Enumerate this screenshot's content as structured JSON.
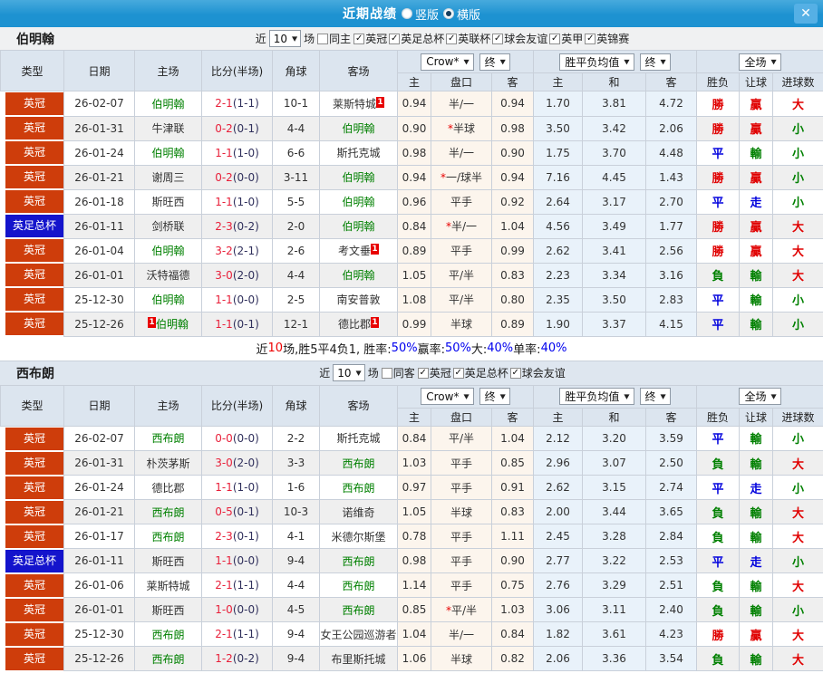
{
  "topbar": {
    "title": "近期战绩",
    "radios": [
      {
        "label": "竖版",
        "selected": false
      },
      {
        "label": "横版",
        "selected": true
      }
    ],
    "close_glyph": "✕"
  },
  "glyphs": {
    "check": "✓",
    "arrow": "▼",
    "star": "*"
  },
  "colors": {
    "topbar_blue": "#1d92d1",
    "close_btn_blue": "#55b0e5",
    "league_orange": "#ce3d0b",
    "league_cup_blue": "#1414cc",
    "team_green": "#008000",
    "score_red": "#e8203a",
    "half_score_navy": "#30305c",
    "odds_col_bg": "#fcf5ed",
    "avg_col_bg": "#e9f2fa",
    "row_stripe": "#efefef",
    "header_bg": "#dce5ef",
    "result_red": "#e00000",
    "result_green": "#008000",
    "result_blue": "#0000dd",
    "percent_blue": "#0000ee",
    "card_red": "#e80000"
  },
  "league_colors": {
    "英冠": "league_orange",
    "英足总杯": "league_cup_blue"
  },
  "result_classes": {
    "勝": "red",
    "負": "green",
    "平": "blue",
    "贏": "red",
    "輸": "green",
    "走": "blue",
    "大": "red",
    "小": "green"
  },
  "table_header": {
    "main": [
      "类型",
      "日期",
      "主场",
      "比分(半场)",
      "角球",
      "客场"
    ],
    "sub": [
      "主",
      "盘口",
      "客",
      "主",
      "和",
      "客",
      "胜负",
      "让球",
      "进球数"
    ],
    "company": "Crow*",
    "period": "终",
    "avg_label": "胜平负均值",
    "full_label": "全场"
  },
  "sections": [
    {
      "team": "伯明翰",
      "filters": {
        "recent_label": "近",
        "count": "10",
        "games_label": "场",
        "same_label": "同主",
        "same_checked": false,
        "leagues": [
          {
            "label": "英冠",
            "checked": true
          },
          {
            "label": "英足总杯",
            "checked": true
          },
          {
            "label": "英联杯",
            "checked": true
          },
          {
            "label": "球会友谊",
            "checked": true
          },
          {
            "label": "英甲",
            "checked": true
          },
          {
            "label": "英锦赛",
            "checked": true
          }
        ]
      },
      "rows": [
        {
          "type": "英冠",
          "date": "26-02-07",
          "home": {
            "name": "伯明翰",
            "green": true
          },
          "ft": "2-1",
          "ht": "(1-1)",
          "corner": "10-1",
          "away": {
            "name": "莱斯特城",
            "card": "1"
          },
          "o1": "0.94",
          "hstar": false,
          "handicap": "半/一",
          "o2": "0.94",
          "a1": "1.70",
          "a2": "3.81",
          "a3": "4.72",
          "res": "勝",
          "hres": "贏",
          "gres": "大"
        },
        {
          "type": "英冠",
          "date": "26-01-31",
          "home": {
            "name": "牛津联"
          },
          "ft": "0-2",
          "ht": "(0-1)",
          "corner": "4-4",
          "away": {
            "name": "伯明翰",
            "green": true
          },
          "o1": "0.90",
          "hstar": true,
          "handicap": "半球",
          "o2": "0.98",
          "a1": "3.50",
          "a2": "3.42",
          "a3": "2.06",
          "res": "勝",
          "hres": "贏",
          "gres": "小"
        },
        {
          "type": "英冠",
          "date": "26-01-24",
          "home": {
            "name": "伯明翰",
            "green": true
          },
          "ft": "1-1",
          "ht": "(1-0)",
          "corner": "6-6",
          "away": {
            "name": "斯托克城"
          },
          "o1": "0.98",
          "hstar": false,
          "handicap": "半/一",
          "o2": "0.90",
          "a1": "1.75",
          "a2": "3.70",
          "a3": "4.48",
          "res": "平",
          "hres": "輸",
          "gres": "小"
        },
        {
          "type": "英冠",
          "date": "26-01-21",
          "home": {
            "name": "谢周三"
          },
          "ft": "0-2",
          "ht": "(0-0)",
          "corner": "3-11",
          "away": {
            "name": "伯明翰",
            "green": true
          },
          "o1": "0.94",
          "hstar": true,
          "handicap": "一/球半",
          "o2": "0.94",
          "a1": "7.16",
          "a2": "4.45",
          "a3": "1.43",
          "res": "勝",
          "hres": "贏",
          "gres": "小"
        },
        {
          "type": "英冠",
          "date": "26-01-18",
          "home": {
            "name": "斯旺西"
          },
          "ft": "1-1",
          "ht": "(1-0)",
          "corner": "5-5",
          "away": {
            "name": "伯明翰",
            "green": true
          },
          "o1": "0.96",
          "hstar": false,
          "handicap": "平手",
          "o2": "0.92",
          "a1": "2.64",
          "a2": "3.17",
          "a3": "2.70",
          "res": "平",
          "hres": "走",
          "gres": "小"
        },
        {
          "type": "英足总杯",
          "date": "26-01-11",
          "home": {
            "name": "剑桥联"
          },
          "ft": "2-3",
          "ht": "(0-2)",
          "corner": "2-0",
          "away": {
            "name": "伯明翰",
            "green": true
          },
          "o1": "0.84",
          "hstar": true,
          "handicap": "半/一",
          "o2": "1.04",
          "a1": "4.56",
          "a2": "3.49",
          "a3": "1.77",
          "res": "勝",
          "hres": "贏",
          "gres": "大"
        },
        {
          "type": "英冠",
          "date": "26-01-04",
          "home": {
            "name": "伯明翰",
            "green": true
          },
          "ft": "3-2",
          "ht": "(2-1)",
          "corner": "2-6",
          "away": {
            "name": "考文垂",
            "card": "1"
          },
          "o1": "0.89",
          "hstar": false,
          "handicap": "平手",
          "o2": "0.99",
          "a1": "2.62",
          "a2": "3.41",
          "a3": "2.56",
          "res": "勝",
          "hres": "贏",
          "gres": "大"
        },
        {
          "type": "英冠",
          "date": "26-01-01",
          "home": {
            "name": "沃特福德"
          },
          "ft": "3-0",
          "ht": "(2-0)",
          "corner": "4-4",
          "away": {
            "name": "伯明翰",
            "green": true
          },
          "o1": "1.05",
          "hstar": false,
          "handicap": "平/半",
          "o2": "0.83",
          "a1": "2.23",
          "a2": "3.34",
          "a3": "3.16",
          "res": "負",
          "hres": "輸",
          "gres": "大"
        },
        {
          "type": "英冠",
          "date": "25-12-30",
          "home": {
            "name": "伯明翰",
            "green": true
          },
          "ft": "1-1",
          "ht": "(0-0)",
          "corner": "2-5",
          "away": {
            "name": "南安普敦"
          },
          "o1": "1.08",
          "hstar": false,
          "handicap": "平/半",
          "o2": "0.80",
          "a1": "2.35",
          "a2": "3.50",
          "a3": "2.83",
          "res": "平",
          "hres": "輸",
          "gres": "小"
        },
        {
          "type": "英冠",
          "date": "25-12-26",
          "home": {
            "name": "伯明翰",
            "green": true,
            "card": "1"
          },
          "ft": "1-1",
          "ht": "(0-1)",
          "corner": "12-1",
          "away": {
            "name": "德比郡",
            "card": "1"
          },
          "o1": "0.99",
          "hstar": false,
          "handicap": "半球",
          "o2": "0.89",
          "a1": "1.90",
          "a2": "3.37",
          "a3": "4.15",
          "res": "平",
          "hres": "輸",
          "gres": "小"
        }
      ],
      "summary": {
        "segments": [
          {
            "t": "近"
          },
          {
            "t": "10",
            "c": "red"
          },
          {
            "t": "场,胜5平4负1, 胜率:"
          },
          {
            "t": "50%",
            "c": "blue"
          },
          {
            "t": " 赢率:"
          },
          {
            "t": "50%",
            "c": "blue"
          },
          {
            "t": " 大:"
          },
          {
            "t": "40%",
            "c": "blue"
          },
          {
            "t": " 单率:"
          },
          {
            "t": "40%",
            "c": "blue"
          }
        ]
      }
    },
    {
      "team": "西布朗",
      "filters": {
        "recent_label": "近",
        "count": "10",
        "games_label": "场",
        "same_label": "同客",
        "same_checked": false,
        "leagues": [
          {
            "label": "英冠",
            "checked": true
          },
          {
            "label": "英足总杯",
            "checked": true
          },
          {
            "label": "球会友谊",
            "checked": true
          }
        ]
      },
      "rows": [
        {
          "type": "英冠",
          "date": "26-02-07",
          "home": {
            "name": "西布朗",
            "green": true
          },
          "ft": "0-0",
          "ht": "(0-0)",
          "corner": "2-2",
          "away": {
            "name": "斯托克城"
          },
          "o1": "0.84",
          "hstar": false,
          "handicap": "平/半",
          "o2": "1.04",
          "a1": "2.12",
          "a2": "3.20",
          "a3": "3.59",
          "res": "平",
          "hres": "輸",
          "gres": "小"
        },
        {
          "type": "英冠",
          "date": "26-01-31",
          "home": {
            "name": "朴茨茅斯"
          },
          "ft": "3-0",
          "ht": "(2-0)",
          "corner": "3-3",
          "away": {
            "name": "西布朗",
            "green": true
          },
          "o1": "1.03",
          "hstar": false,
          "handicap": "平手",
          "o2": "0.85",
          "a1": "2.96",
          "a2": "3.07",
          "a3": "2.50",
          "res": "負",
          "hres": "輸",
          "gres": "大"
        },
        {
          "type": "英冠",
          "date": "26-01-24",
          "home": {
            "name": "德比郡"
          },
          "ft": "1-1",
          "ht": "(1-0)",
          "corner": "1-6",
          "away": {
            "name": "西布朗",
            "green": true
          },
          "o1": "0.97",
          "hstar": false,
          "handicap": "平手",
          "o2": "0.91",
          "a1": "2.62",
          "a2": "3.15",
          "a3": "2.74",
          "res": "平",
          "hres": "走",
          "gres": "小"
        },
        {
          "type": "英冠",
          "date": "26-01-21",
          "home": {
            "name": "西布朗",
            "green": true
          },
          "ft": "0-5",
          "ht": "(0-1)",
          "corner": "10-3",
          "away": {
            "name": "诺维奇"
          },
          "o1": "1.05",
          "hstar": false,
          "handicap": "半球",
          "o2": "0.83",
          "a1": "2.00",
          "a2": "3.44",
          "a3": "3.65",
          "res": "負",
          "hres": "輸",
          "gres": "大"
        },
        {
          "type": "英冠",
          "date": "26-01-17",
          "home": {
            "name": "西布朗",
            "green": true
          },
          "ft": "2-3",
          "ht": "(0-1)",
          "corner": "4-1",
          "away": {
            "name": "米德尔斯堡"
          },
          "o1": "0.78",
          "hstar": false,
          "handicap": "平手",
          "o2": "1.11",
          "a1": "2.45",
          "a2": "3.28",
          "a3": "2.84",
          "res": "負",
          "hres": "輸",
          "gres": "大"
        },
        {
          "type": "英足总杯",
          "date": "26-01-11",
          "home": {
            "name": "斯旺西"
          },
          "ft": "1-1",
          "ht": "(0-0)",
          "corner": "9-4",
          "away": {
            "name": "西布朗",
            "green": true
          },
          "o1": "0.98",
          "hstar": false,
          "handicap": "平手",
          "o2": "0.90",
          "a1": "2.77",
          "a2": "3.22",
          "a3": "2.53",
          "res": "平",
          "hres": "走",
          "gres": "小"
        },
        {
          "type": "英冠",
          "date": "26-01-06",
          "home": {
            "name": "莱斯特城"
          },
          "ft": "2-1",
          "ht": "(1-1)",
          "corner": "4-4",
          "away": {
            "name": "西布朗",
            "green": true
          },
          "o1": "1.14",
          "hstar": false,
          "handicap": "平手",
          "o2": "0.75",
          "a1": "2.76",
          "a2": "3.29",
          "a3": "2.51",
          "res": "負",
          "hres": "輸",
          "gres": "大"
        },
        {
          "type": "英冠",
          "date": "26-01-01",
          "home": {
            "name": "斯旺西"
          },
          "ft": "1-0",
          "ht": "(0-0)",
          "corner": "4-5",
          "away": {
            "name": "西布朗",
            "green": true
          },
          "o1": "0.85",
          "hstar": true,
          "handicap": "平/半",
          "o2": "1.03",
          "a1": "3.06",
          "a2": "3.11",
          "a3": "2.40",
          "res": "負",
          "hres": "輸",
          "gres": "小"
        },
        {
          "type": "英冠",
          "date": "25-12-30",
          "home": {
            "name": "西布朗",
            "green": true
          },
          "ft": "2-1",
          "ht": "(1-1)",
          "corner": "9-4",
          "away": {
            "name": "女王公园巡游者"
          },
          "o1": "1.04",
          "hstar": false,
          "handicap": "半/一",
          "o2": "0.84",
          "a1": "1.82",
          "a2": "3.61",
          "a3": "4.23",
          "res": "勝",
          "hres": "贏",
          "gres": "大"
        },
        {
          "type": "英冠",
          "date": "25-12-26",
          "home": {
            "name": "西布朗",
            "green": true
          },
          "ft": "1-2",
          "ht": "(0-2)",
          "corner": "9-4",
          "away": {
            "name": "布里斯托城"
          },
          "o1": "1.06",
          "hstar": false,
          "handicap": "半球",
          "o2": "0.82",
          "a1": "2.06",
          "a2": "3.36",
          "a3": "3.54",
          "res": "負",
          "hres": "輸",
          "gres": "大"
        }
      ],
      "summary": null
    }
  ]
}
